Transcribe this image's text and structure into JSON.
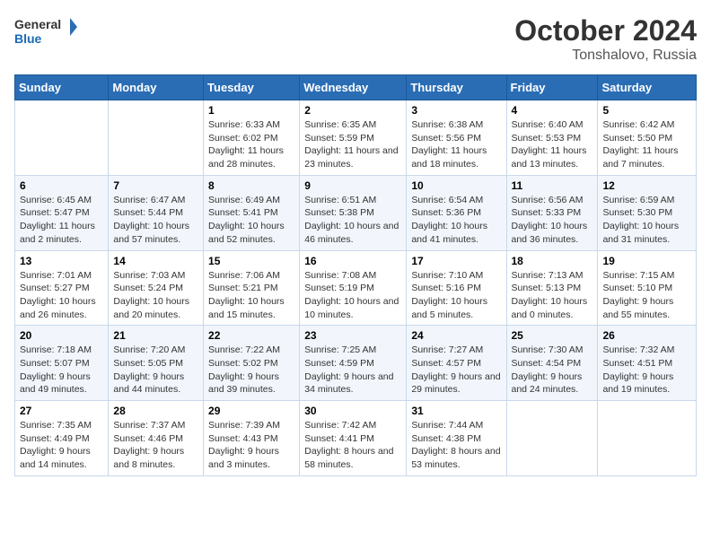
{
  "header": {
    "logo_general": "General",
    "logo_blue": "Blue",
    "month_title": "October 2024",
    "location": "Tonshalovo, Russia"
  },
  "days_of_week": [
    "Sunday",
    "Monday",
    "Tuesday",
    "Wednesday",
    "Thursday",
    "Friday",
    "Saturday"
  ],
  "weeks": [
    [
      {
        "day": "",
        "detail": ""
      },
      {
        "day": "",
        "detail": ""
      },
      {
        "day": "1",
        "detail": "Sunrise: 6:33 AM\nSunset: 6:02 PM\nDaylight: 11 hours and 28 minutes."
      },
      {
        "day": "2",
        "detail": "Sunrise: 6:35 AM\nSunset: 5:59 PM\nDaylight: 11 hours and 23 minutes."
      },
      {
        "day": "3",
        "detail": "Sunrise: 6:38 AM\nSunset: 5:56 PM\nDaylight: 11 hours and 18 minutes."
      },
      {
        "day": "4",
        "detail": "Sunrise: 6:40 AM\nSunset: 5:53 PM\nDaylight: 11 hours and 13 minutes."
      },
      {
        "day": "5",
        "detail": "Sunrise: 6:42 AM\nSunset: 5:50 PM\nDaylight: 11 hours and 7 minutes."
      }
    ],
    [
      {
        "day": "6",
        "detail": "Sunrise: 6:45 AM\nSunset: 5:47 PM\nDaylight: 11 hours and 2 minutes."
      },
      {
        "day": "7",
        "detail": "Sunrise: 6:47 AM\nSunset: 5:44 PM\nDaylight: 10 hours and 57 minutes."
      },
      {
        "day": "8",
        "detail": "Sunrise: 6:49 AM\nSunset: 5:41 PM\nDaylight: 10 hours and 52 minutes."
      },
      {
        "day": "9",
        "detail": "Sunrise: 6:51 AM\nSunset: 5:38 PM\nDaylight: 10 hours and 46 minutes."
      },
      {
        "day": "10",
        "detail": "Sunrise: 6:54 AM\nSunset: 5:36 PM\nDaylight: 10 hours and 41 minutes."
      },
      {
        "day": "11",
        "detail": "Sunrise: 6:56 AM\nSunset: 5:33 PM\nDaylight: 10 hours and 36 minutes."
      },
      {
        "day": "12",
        "detail": "Sunrise: 6:59 AM\nSunset: 5:30 PM\nDaylight: 10 hours and 31 minutes."
      }
    ],
    [
      {
        "day": "13",
        "detail": "Sunrise: 7:01 AM\nSunset: 5:27 PM\nDaylight: 10 hours and 26 minutes."
      },
      {
        "day": "14",
        "detail": "Sunrise: 7:03 AM\nSunset: 5:24 PM\nDaylight: 10 hours and 20 minutes."
      },
      {
        "day": "15",
        "detail": "Sunrise: 7:06 AM\nSunset: 5:21 PM\nDaylight: 10 hours and 15 minutes."
      },
      {
        "day": "16",
        "detail": "Sunrise: 7:08 AM\nSunset: 5:19 PM\nDaylight: 10 hours and 10 minutes."
      },
      {
        "day": "17",
        "detail": "Sunrise: 7:10 AM\nSunset: 5:16 PM\nDaylight: 10 hours and 5 minutes."
      },
      {
        "day": "18",
        "detail": "Sunrise: 7:13 AM\nSunset: 5:13 PM\nDaylight: 10 hours and 0 minutes."
      },
      {
        "day": "19",
        "detail": "Sunrise: 7:15 AM\nSunset: 5:10 PM\nDaylight: 9 hours and 55 minutes."
      }
    ],
    [
      {
        "day": "20",
        "detail": "Sunrise: 7:18 AM\nSunset: 5:07 PM\nDaylight: 9 hours and 49 minutes."
      },
      {
        "day": "21",
        "detail": "Sunrise: 7:20 AM\nSunset: 5:05 PM\nDaylight: 9 hours and 44 minutes."
      },
      {
        "day": "22",
        "detail": "Sunrise: 7:22 AM\nSunset: 5:02 PM\nDaylight: 9 hours and 39 minutes."
      },
      {
        "day": "23",
        "detail": "Sunrise: 7:25 AM\nSunset: 4:59 PM\nDaylight: 9 hours and 34 minutes."
      },
      {
        "day": "24",
        "detail": "Sunrise: 7:27 AM\nSunset: 4:57 PM\nDaylight: 9 hours and 29 minutes."
      },
      {
        "day": "25",
        "detail": "Sunrise: 7:30 AM\nSunset: 4:54 PM\nDaylight: 9 hours and 24 minutes."
      },
      {
        "day": "26",
        "detail": "Sunrise: 7:32 AM\nSunset: 4:51 PM\nDaylight: 9 hours and 19 minutes."
      }
    ],
    [
      {
        "day": "27",
        "detail": "Sunrise: 7:35 AM\nSunset: 4:49 PM\nDaylight: 9 hours and 14 minutes."
      },
      {
        "day": "28",
        "detail": "Sunrise: 7:37 AM\nSunset: 4:46 PM\nDaylight: 9 hours and 8 minutes."
      },
      {
        "day": "29",
        "detail": "Sunrise: 7:39 AM\nSunset: 4:43 PM\nDaylight: 9 hours and 3 minutes."
      },
      {
        "day": "30",
        "detail": "Sunrise: 7:42 AM\nSunset: 4:41 PM\nDaylight: 8 hours and 58 minutes."
      },
      {
        "day": "31",
        "detail": "Sunrise: 7:44 AM\nSunset: 4:38 PM\nDaylight: 8 hours and 53 minutes."
      },
      {
        "day": "",
        "detail": ""
      },
      {
        "day": "",
        "detail": ""
      }
    ]
  ]
}
